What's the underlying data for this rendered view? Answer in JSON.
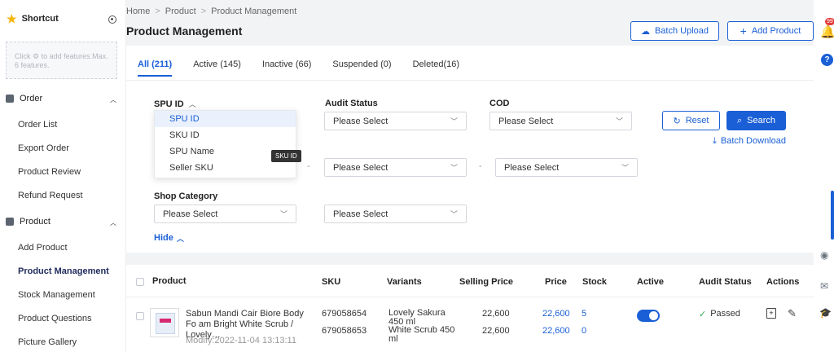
{
  "sidebar": {
    "shortcut_title": "Shortcut",
    "shortcut_hint": "Click ⚙ to add features.Max. 6 features.",
    "groups": [
      {
        "label": "Order",
        "items": [
          "Order List",
          "Export Order",
          "Product Review",
          "Refund Request"
        ]
      },
      {
        "label": "Product",
        "items": [
          "Add Product",
          "Product Management",
          "Stock Management",
          "Product Questions",
          "Picture Gallery"
        ]
      }
    ]
  },
  "breadcrumb": [
    "Home",
    "Product",
    "Product Management"
  ],
  "page_title": "Product Management",
  "header_buttons": {
    "batch_upload": "Batch Upload",
    "add_product": "Add Product"
  },
  "tabs": [
    {
      "label": "All (211)",
      "active": true
    },
    {
      "label": "Active (145)"
    },
    {
      "label": "Inactive (66)"
    },
    {
      "label": "Suspended (0)"
    },
    {
      "label": "Deleted(16)"
    }
  ],
  "filters": {
    "spu_label": "SPU ID",
    "spu_options": [
      "SPU ID",
      "SKU ID",
      "SPU Name",
      "Seller SKU"
    ],
    "tooltip": "SKU ID",
    "audit_label": "Audit Status",
    "cod_label": "COD",
    "placeholder": "Please Select",
    "shop_category_label": "Shop Category",
    "reset": "Reset",
    "search": "Search",
    "batch_download": "Batch Download",
    "hide": "Hide",
    "dash": "-"
  },
  "table": {
    "headers": [
      "Product",
      "SKU",
      "Variants",
      "Selling Price",
      "Price",
      "Stock",
      "Active",
      "Audit Status",
      "Actions"
    ],
    "row": {
      "name": "Sabun Mandi Cair Biore Body Fo am Bright White Scrub / Lovely…",
      "modify": "Modify:2022-11-04 13:13:11",
      "skus": [
        {
          "sku": "679058654",
          "variant": "Lovely Sakura 450 ml",
          "selling": "22,600",
          "price": "22,600",
          "stock": "5"
        },
        {
          "sku": "679058653",
          "variant": "White Scrub 450 ml",
          "selling": "22,600",
          "price": "22,600",
          "stock": "0"
        }
      ],
      "audit": "Passed"
    }
  },
  "notification_count": "99",
  "colors": {
    "accent": "#1a5fd6",
    "passed": "#2fa84f"
  }
}
